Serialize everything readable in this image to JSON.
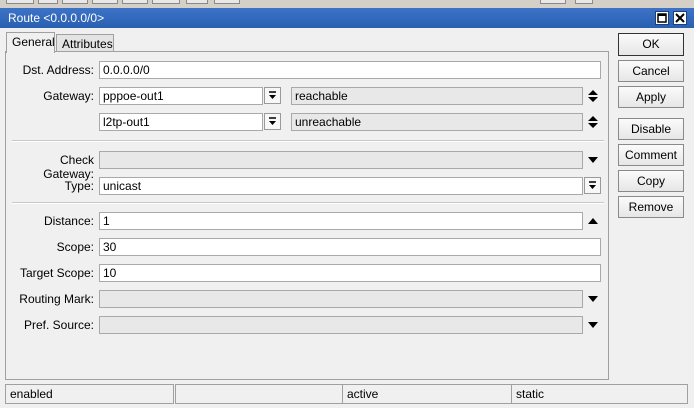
{
  "window": {
    "title": "Route <0.0.0.0/0>"
  },
  "tabs": [
    {
      "label": "General"
    },
    {
      "label": "Attributes"
    }
  ],
  "form": {
    "dst_address": {
      "label": "Dst. Address:",
      "value": "0.0.0.0/0"
    },
    "gateway": {
      "label": "Gateway:",
      "rows": [
        {
          "value": "pppoe-out1",
          "status": "reachable"
        },
        {
          "value": "l2tp-out1",
          "status": "unreachable"
        }
      ]
    },
    "check_gateway": {
      "label": "Check Gateway:",
      "value": ""
    },
    "type": {
      "label": "Type:",
      "value": "unicast"
    },
    "distance": {
      "label": "Distance:",
      "value": "1"
    },
    "scope": {
      "label": "Scope:",
      "value": "30"
    },
    "target_scope": {
      "label": "Target Scope:",
      "value": "10"
    },
    "routing_mark": {
      "label": "Routing Mark:",
      "value": ""
    },
    "pref_source": {
      "label": "Pref. Source:",
      "value": ""
    }
  },
  "buttons": {
    "ok": "OK",
    "cancel": "Cancel",
    "apply": "Apply",
    "disable": "Disable",
    "comment": "Comment",
    "copy": "Copy",
    "remove": "Remove"
  },
  "status": [
    "enabled",
    "",
    "active",
    "static"
  ],
  "colors": {
    "titlebar": "#2a5fb0",
    "panel_bg": "#f0f0f0",
    "readonly_field": "#e8e8e8"
  }
}
